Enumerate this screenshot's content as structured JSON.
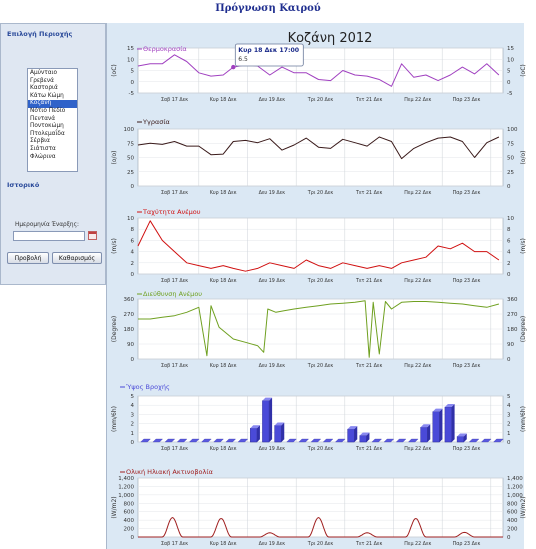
{
  "page": {
    "title": "Πρόγνωση Καιρού"
  },
  "sidebar": {
    "region_heading": "Επιλογή Περιοχής",
    "regions": [
      "Αμύνταιο",
      "Γρεβενά",
      "Καστοριά",
      "Κάτω Κώμη",
      "Κοζάνη",
      "Νότιο Πεδίο",
      "Πεντανά",
      "Ποντοκώμη",
      "Πτολεμαΐδα",
      "Σέρβια",
      "Σιάτιστα",
      "Φλώρινα"
    ],
    "selected_region": "Κοζάνη",
    "history_heading": "Ιστορικό",
    "start_date_label": "Ημερομηνία Έναρξης:",
    "start_date_value": "",
    "view_button": "Προβολή",
    "clear_button": "Καθαρισμός"
  },
  "colors": {
    "temperature": "#a040c0",
    "humidity": "#3a1a1a",
    "wind_speed": "#d01010",
    "wind_direction": "#6fa020",
    "rain": "#4a4ad8",
    "solar": "#a02020"
  },
  "chart_data": {
    "title": "Κοζάνη 2012",
    "x_labels": [
      "Σαβ 17 Δεκ",
      "Κυρ 18 Δεκ",
      "Δευ 19 Δεκ",
      "Τρι 20 Δεκ",
      "Τετ 21 Δεκ",
      "Πεμ 22 Δεκ",
      "Παρ 23 Δεκ",
      "Σαβ 24 Δεκ"
    ],
    "x_range_hours": [
      -6,
      174
    ],
    "tooltip": {
      "title": "Κυρ 18 Δεκ 17:00",
      "value": "6.5",
      "hour": 41
    },
    "panels": [
      {
        "key": "temperature",
        "type": "line",
        "series_name": "Θερμοκρασία",
        "ylabel": "(oC)",
        "ylim": [
          -5,
          15
        ],
        "ticks": [
          -5,
          0,
          5,
          10,
          15
        ],
        "x": [
          -6,
          0,
          6,
          12,
          18,
          24,
          30,
          36,
          41,
          47,
          53,
          59,
          65,
          71,
          77,
          83,
          89,
          95,
          101,
          107,
          113,
          119,
          124,
          130,
          136,
          142,
          148,
          154,
          160,
          166,
          172
        ],
        "y": [
          7,
          8,
          8,
          12,
          9,
          4,
          2.5,
          3,
          6.5,
          7.5,
          7,
          3,
          6.5,
          4,
          4,
          1,
          0.5,
          5,
          3,
          2.5,
          1,
          -2,
          8,
          2,
          3,
          0.5,
          3,
          6.5,
          3.5,
          8,
          3
        ]
      },
      {
        "key": "humidity",
        "type": "line",
        "series_name": "Υγρασία",
        "ylabel": "(o/o)",
        "ylim": [
          0,
          100
        ],
        "ticks": [
          0,
          25,
          50,
          75,
          100
        ],
        "x": [
          -6,
          0,
          6,
          12,
          18,
          24,
          30,
          36,
          41,
          47,
          53,
          59,
          65,
          71,
          77,
          83,
          89,
          95,
          101,
          107,
          113,
          119,
          124,
          130,
          136,
          142,
          148,
          154,
          160,
          166,
          172
        ],
        "y": [
          72,
          75,
          73,
          78,
          70,
          70,
          55,
          56,
          78,
          80,
          76,
          83,
          63,
          72,
          84,
          68,
          66,
          82,
          76,
          70,
          86,
          78,
          48,
          66,
          76,
          84,
          86,
          78,
          50,
          76,
          86
        ]
      },
      {
        "key": "wind_speed",
        "type": "line",
        "series_name": "Ταχύτητα Ανέμου",
        "ylabel": "(m/s)",
        "ylim": [
          0,
          10
        ],
        "ticks": [
          0,
          2,
          4,
          6,
          8,
          10
        ],
        "x": [
          -6,
          0,
          6,
          12,
          18,
          24,
          30,
          36,
          41,
          47,
          53,
          59,
          65,
          71,
          77,
          83,
          89,
          95,
          101,
          107,
          113,
          119,
          124,
          130,
          136,
          142,
          148,
          154,
          160,
          166,
          172
        ],
        "y": [
          5,
          9.5,
          6,
          4,
          2,
          1.5,
          1,
          1.5,
          1,
          0.5,
          1,
          2,
          1.5,
          1,
          2.5,
          1.5,
          1,
          2,
          1.5,
          1,
          1.5,
          1,
          2,
          2.5,
          3,
          5,
          4.5,
          5.5,
          4,
          4,
          2.5
        ]
      },
      {
        "key": "wind_direction",
        "type": "line",
        "series_name": "Διεύθυνση Ανέμου",
        "ylabel": "(Degree)",
        "ylim": [
          0,
          360
        ],
        "ticks": [
          0,
          90,
          180,
          270,
          360
        ],
        "x": [
          -6,
          0,
          6,
          12,
          18,
          24,
          28,
          30,
          34,
          41,
          47,
          53,
          56,
          58,
          62,
          66,
          71,
          77,
          83,
          89,
          95,
          101,
          106,
          108,
          110,
          113,
          116,
          119,
          124,
          130,
          136,
          142,
          148,
          154,
          160,
          166,
          172
        ],
        "y": [
          240,
          240,
          250,
          260,
          280,
          310,
          20,
          320,
          190,
          120,
          100,
          80,
          40,
          300,
          280,
          290,
          300,
          310,
          320,
          330,
          335,
          340,
          350,
          10,
          340,
          30,
          345,
          300,
          340,
          345,
          345,
          340,
          335,
          330,
          320,
          310,
          330
        ]
      },
      {
        "key": "rain",
        "type": "bar",
        "series_name": "Ύψος Βροχής",
        "ylabel": "(mm/6h)",
        "ylim": [
          0,
          5
        ],
        "ticks": [
          0,
          1,
          2,
          3,
          4,
          5
        ],
        "x": [
          -6,
          0,
          6,
          12,
          18,
          24,
          30,
          36,
          42,
          48,
          54,
          60,
          66,
          72,
          78,
          84,
          90,
          96,
          102,
          108,
          114,
          120,
          126,
          132,
          138,
          144,
          150,
          156,
          162,
          168
        ],
        "y": [
          0,
          0,
          0,
          0,
          0,
          0,
          0,
          0,
          0,
          1.5,
          4.5,
          1.8,
          0,
          0,
          0,
          0,
          0,
          1.4,
          0.7,
          0,
          0,
          0,
          0,
          1.6,
          3.3,
          3.8,
          0.6,
          0,
          0,
          0
        ]
      },
      {
        "key": "solar",
        "type": "line",
        "series_name": "Ολική Ηλιακή Ακτινοβολία",
        "ylabel": "(W/m2)",
        "ylim": [
          0,
          1400
        ],
        "ticks": [
          0,
          200,
          400,
          600,
          800,
          1000,
          1200,
          1400
        ],
        "peaks": [
          {
            "hour": 11,
            "value": 460
          },
          {
            "hour": 35,
            "value": 440
          },
          {
            "hour": 59,
            "value": 100
          },
          {
            "hour": 83,
            "value": 460
          },
          {
            "hour": 107,
            "value": 100
          },
          {
            "hour": 131,
            "value": 440
          },
          {
            "hour": 155,
            "value": 110
          }
        ]
      }
    ]
  }
}
